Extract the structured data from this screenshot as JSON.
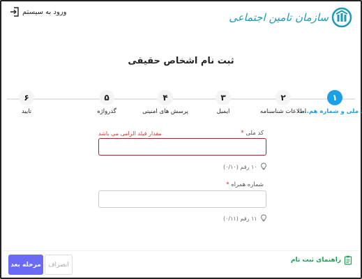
{
  "header": {
    "logo_text": "سازمان تامین اجتماعی",
    "login_label": "ورود به سیستم"
  },
  "page_title": "ثبت نام اشخاص حقیقی",
  "steps": [
    {
      "number": "۱",
      "label": "کد ملی و شماره هم..."
    },
    {
      "number": "۲",
      "label": "اطلاعات شناسنامه"
    },
    {
      "number": "۳",
      "label": "ایمیل"
    },
    {
      "number": "۴",
      "label": "پرسش های امنیتی"
    },
    {
      "number": "۵",
      "label": "گذرواژه"
    },
    {
      "number": "۶",
      "label": "تایید"
    }
  ],
  "form": {
    "national_code": {
      "label": "کد ملی",
      "required_mark": "*",
      "value": "",
      "error": "مقدار فیلد الزامی می باشد",
      "hint": "۱۰ رقم (۰/۱۰)"
    },
    "mobile": {
      "label": "شماره همراه",
      "required_mark": "*",
      "value": "",
      "hint": "۱۱ رقم (۰/۱۱)"
    }
  },
  "footer": {
    "guide_label": "راهنمای ثبت نام",
    "next_label": "مرحله بعد",
    "cancel_label": "انصراف"
  },
  "colors": {
    "active_step": "#1aa0e6",
    "error": "#c8102e",
    "primary_button": "#6a6af4",
    "guide": "#1f9e5a"
  }
}
